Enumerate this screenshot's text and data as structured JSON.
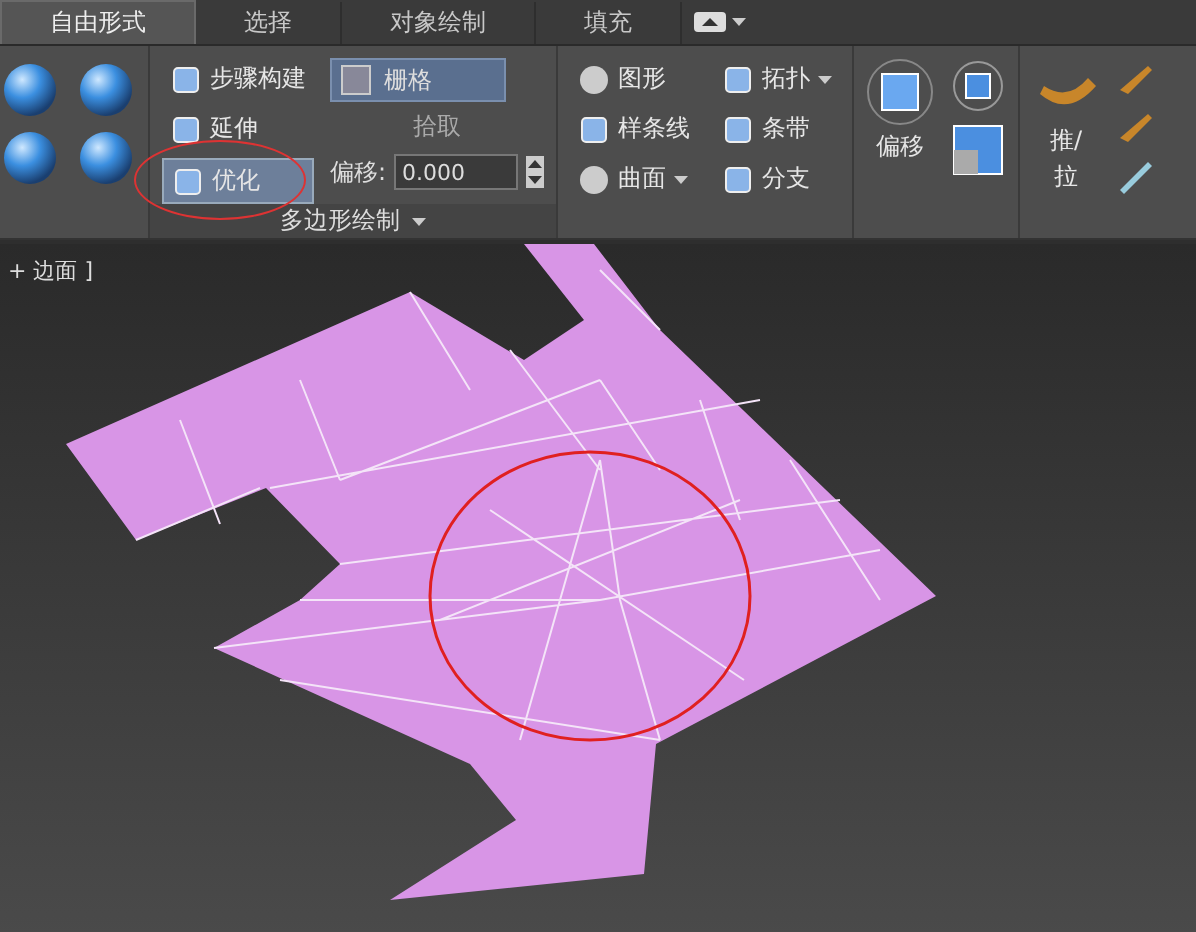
{
  "tabs": [
    {
      "label": "自由形式",
      "selected": true
    },
    {
      "label": "选择",
      "selected": false
    },
    {
      "label": "对象绘制",
      "selected": false
    },
    {
      "label": "填充",
      "selected": false
    }
  ],
  "polydraw": {
    "items": [
      {
        "label": "步骤构建",
        "selected": false
      },
      {
        "label": "延伸",
        "selected": false
      },
      {
        "label": "优化",
        "selected": true
      }
    ],
    "grid_dropdown": {
      "value": "栅格"
    },
    "pick_button": "拾取",
    "offset": {
      "label": "偏移:",
      "value": "0.000"
    },
    "group_label": "多边形绘制"
  },
  "shape_tools": [
    {
      "label": "图形",
      "dropdown": false
    },
    {
      "label": "样条线",
      "dropdown": false
    },
    {
      "label": "曲面",
      "dropdown": true
    },
    {
      "label": "拓扑",
      "dropdown": true
    },
    {
      "label": "条带",
      "dropdown": false
    },
    {
      "label": "分支",
      "dropdown": false
    }
  ],
  "offset_tool": "偏移",
  "push_pull": "推/拉",
  "viewport": {
    "label": "+ 边面 ]"
  }
}
